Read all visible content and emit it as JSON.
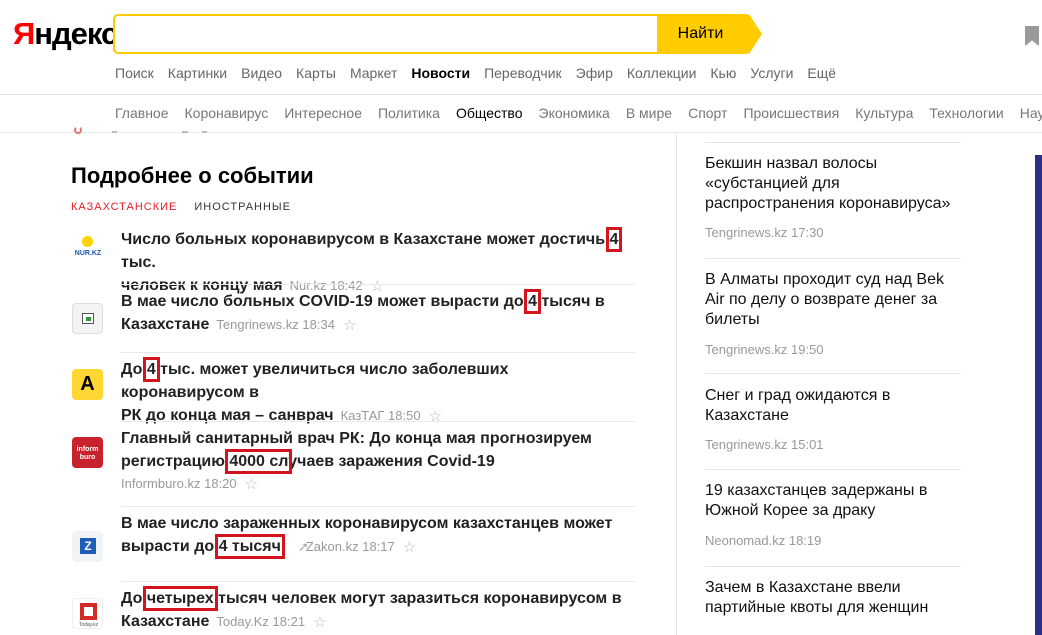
{
  "logo": {
    "first": "Я",
    "rest": "ндекс"
  },
  "search": {
    "value": "",
    "placeholder": "",
    "button": "Найти"
  },
  "services": [
    {
      "label": "Поиск",
      "active": false
    },
    {
      "label": "Картинки",
      "active": false
    },
    {
      "label": "Видео",
      "active": false
    },
    {
      "label": "Карты",
      "active": false
    },
    {
      "label": "Маркет",
      "active": false
    },
    {
      "label": "Новости",
      "active": true
    },
    {
      "label": "Переводчик",
      "active": false
    },
    {
      "label": "Эфир",
      "active": false
    },
    {
      "label": "Коллекции",
      "active": false
    },
    {
      "label": "Кью",
      "active": false
    },
    {
      "label": "Услуги",
      "active": false
    },
    {
      "label": "Ещё",
      "active": false
    }
  ],
  "rubrics": [
    {
      "label": "Главное",
      "active": false
    },
    {
      "label": "Коронавирус",
      "active": false
    },
    {
      "label": "Интересное",
      "active": false
    },
    {
      "label": "Политика",
      "active": false
    },
    {
      "label": "Общество",
      "active": true
    },
    {
      "label": "Экономика",
      "active": false
    },
    {
      "label": "В мире",
      "active": false
    },
    {
      "label": "Спорт",
      "active": false
    },
    {
      "label": "Происшествия",
      "active": false
    },
    {
      "label": "Культура",
      "active": false
    },
    {
      "label": "Технологии",
      "active": false
    },
    {
      "label": "Нау",
      "active": false
    }
  ],
  "main": {
    "title": "Подробнее о событии",
    "tabs": [
      {
        "label": "Казахстанские",
        "active": true
      },
      {
        "label": "Иностранные",
        "active": false
      }
    ],
    "news": [
      {
        "pre": "Число больных коронавирусом в Казахстане может достичь ",
        "hl": "4",
        "post": " тыс.",
        "line2": "человек к концу мая",
        "source": "Nur.kz",
        "time": "18:42",
        "logo": "nur",
        "logo_text": "NUR.KZ"
      },
      {
        "pre": "В мае число больных COVID-19 может вырасти до ",
        "hl": "4",
        "post": " тысяч в",
        "line2": "Казахстане",
        "source": "Tengrinews.kz",
        "time": "18:34",
        "logo": "tengri"
      },
      {
        "pre": "До ",
        "hl": "4",
        "post": " тыс. может увеличиться число заболевших коронавирусом в",
        "line2": "РК до конца мая – санврач",
        "source": "КазТАГ",
        "time": "18:50",
        "logo": "kaztag"
      },
      {
        "pre": "Главный санитарный врач РК: До конца мая прогнозируем",
        "line2_pre": "регистрацию ",
        "hl": "4000 сл",
        "line2_post": "учаев заражения Covid-19",
        "source": "Informburo.kz",
        "time": "18:20",
        "logo": "informburo",
        "logo_text": "inform buro"
      },
      {
        "pre": "В мае число зараженных коронавирусом казахстанцев может",
        "line2_pre": "вырасти до ",
        "hl": "4 тысяч",
        "source": "Zakon.kz",
        "time": "18:17",
        "logo": "zakon"
      },
      {
        "pre": "До ",
        "hl": "четырех",
        "post": " тысяч человек могут заразиться коронавирусом в",
        "line2": "Казахстане",
        "source": "Today.Kz",
        "time": "18:21",
        "logo": "today",
        "logo_text": "Today.kz"
      }
    ]
  },
  "side": [
    {
      "title": "Бекшин назвал волосы «субстанцией для распространения коронавируса»",
      "source": "Tengrinews.kz",
      "time": "17:30"
    },
    {
      "title": "В Алматы проходит суд над Bek Air по делу о возврате денег за билеты",
      "source": "Tengrinews.kz",
      "time": "19:50"
    },
    {
      "title": "Снег и град ожидаются в Казахстане",
      "source": "Tengrinews.kz",
      "time": "15:01"
    },
    {
      "title": "19 казахстанцев задержаны в Южной Корее за драку",
      "source": "Neonomad.kz",
      "time": "18:19"
    },
    {
      "title": "Зачем в Казахстане ввели партийные квоты для женщин",
      "source": "",
      "time": ""
    }
  ],
  "colors": {
    "accent": "#ffcc00",
    "highlight": "#d4141c",
    "tab_active": "#e8202a",
    "side_accent": "#2b2f88"
  }
}
